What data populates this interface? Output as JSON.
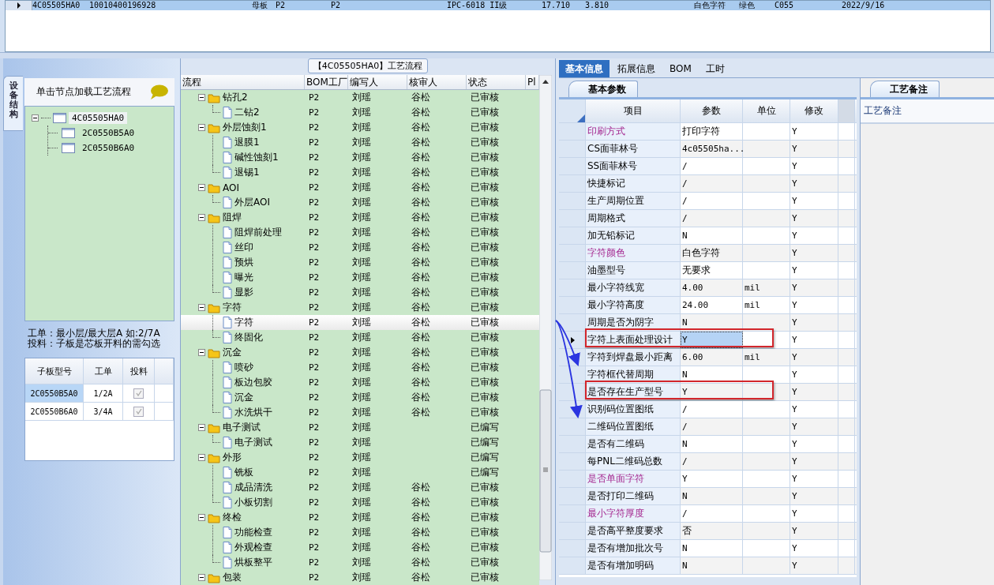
{
  "top_grid": {
    "rows": [
      {
        "selected": true,
        "cells": [
          "4C05505HA0",
          "10010400196928",
          "母板",
          "P2",
          "P2",
          "IPC-6018 II级",
          "17.710",
          "3.810",
          "白色字符",
          "绿色",
          "C055",
          "2022/9/16"
        ]
      }
    ]
  },
  "left_panel": {
    "side_tab": "设备结构",
    "hint": "单击节点加载工艺流程",
    "tree": [
      {
        "label": "4C05505HA0",
        "expanded": true,
        "selected": true,
        "children": [
          {
            "label": "2C0550B5A0",
            "selected": false
          },
          {
            "label": "2C0550B6A0",
            "selected": false
          }
        ]
      }
    ],
    "notes": [
      "工单：最小层/最大层A 如:2/7A",
      "投料：子板是芯板开料的需勾选"
    ],
    "table": {
      "columns": [
        "子板型号",
        "工单",
        "投料"
      ],
      "rows": [
        {
          "board": "2C0550B5A0",
          "order": "1/2A",
          "checked": true,
          "selected": true
        },
        {
          "board": "2C0550B6A0",
          "order": "3/4A",
          "checked": true,
          "selected": false
        }
      ]
    }
  },
  "flow": {
    "title": "【4C05505HA0】工艺流程",
    "columns": [
      "流程",
      "BOM工厂",
      "编写人",
      "核审人",
      "状态",
      "Pl"
    ],
    "tree": [
      {
        "kind": "folder",
        "label": "钻孔2",
        "expanded": true,
        "selected": false,
        "bom": "P2",
        "author": "刘瑶",
        "reviewer": "谷松",
        "status": "已审核",
        "children": [
          {
            "kind": "file",
            "label": "二钻2",
            "selected": false,
            "bom": "P2",
            "author": "刘瑶",
            "reviewer": "谷松",
            "status": "已审核"
          }
        ]
      },
      {
        "kind": "folder",
        "label": "外层蚀刻1",
        "expanded": true,
        "selected": false,
        "bom": "P2",
        "author": "刘瑶",
        "reviewer": "谷松",
        "status": "已审核",
        "children": [
          {
            "kind": "file",
            "label": "退膜1",
            "selected": false,
            "bom": "P2",
            "author": "刘瑶",
            "reviewer": "谷松",
            "status": "已审核"
          },
          {
            "kind": "file",
            "label": "碱性蚀刻1",
            "selected": false,
            "bom": "P2",
            "author": "刘瑶",
            "reviewer": "谷松",
            "status": "已审核"
          },
          {
            "kind": "file",
            "label": "退锡1",
            "selected": false,
            "bom": "P2",
            "author": "刘瑶",
            "reviewer": "谷松",
            "status": "已审核"
          }
        ]
      },
      {
        "kind": "folder",
        "label": "AOI",
        "expanded": true,
        "selected": false,
        "bom": "P2",
        "author": "刘瑶",
        "reviewer": "谷松",
        "status": "已审核",
        "children": [
          {
            "kind": "file",
            "label": "外层AOI",
            "selected": false,
            "bom": "P2",
            "author": "刘瑶",
            "reviewer": "谷松",
            "status": "已审核"
          }
        ]
      },
      {
        "kind": "folder",
        "label": "阻焊",
        "expanded": true,
        "selected": false,
        "bom": "P2",
        "author": "刘瑶",
        "reviewer": "谷松",
        "status": "已审核",
        "children": [
          {
            "kind": "file",
            "label": "阻焊前处理",
            "selected": false,
            "bom": "P2",
            "author": "刘瑶",
            "reviewer": "谷松",
            "status": "已审核"
          },
          {
            "kind": "file",
            "label": "丝印",
            "selected": false,
            "bom": "P2",
            "author": "刘瑶",
            "reviewer": "谷松",
            "status": "已审核"
          },
          {
            "kind": "file",
            "label": "预烘",
            "selected": false,
            "bom": "P2",
            "author": "刘瑶",
            "reviewer": "谷松",
            "status": "已审核"
          },
          {
            "kind": "file",
            "label": "曝光",
            "selected": false,
            "bom": "P2",
            "author": "刘瑶",
            "reviewer": "谷松",
            "status": "已审核"
          },
          {
            "kind": "file",
            "label": "显影",
            "selected": false,
            "bom": "P2",
            "author": "刘瑶",
            "reviewer": "谷松",
            "status": "已审核"
          }
        ]
      },
      {
        "kind": "folder",
        "label": "字符",
        "expanded": true,
        "selected": false,
        "bom": "P2",
        "author": "刘瑶",
        "reviewer": "谷松",
        "status": "已审核",
        "children": [
          {
            "kind": "file",
            "label": "字符",
            "selected": true,
            "bom": "P2",
            "author": "刘瑶",
            "reviewer": "谷松",
            "status": "已审核"
          },
          {
            "kind": "file",
            "label": "终固化",
            "selected": false,
            "bom": "P2",
            "author": "刘瑶",
            "reviewer": "谷松",
            "status": "已审核"
          }
        ]
      },
      {
        "kind": "folder",
        "label": "沉金",
        "expanded": true,
        "selected": false,
        "bom": "P2",
        "author": "刘瑶",
        "reviewer": "谷松",
        "status": "已审核",
        "children": [
          {
            "kind": "file",
            "label": "喷砂",
            "selected": false,
            "bom": "P2",
            "author": "刘瑶",
            "reviewer": "谷松",
            "status": "已审核"
          },
          {
            "kind": "file",
            "label": "板边包胶",
            "selected": false,
            "bom": "P2",
            "author": "刘瑶",
            "reviewer": "谷松",
            "status": "已审核"
          },
          {
            "kind": "file",
            "label": "沉金",
            "selected": false,
            "bom": "P2",
            "author": "刘瑶",
            "reviewer": "谷松",
            "status": "已审核"
          },
          {
            "kind": "file",
            "label": "水洗烘干",
            "selected": false,
            "bom": "P2",
            "author": "刘瑶",
            "reviewer": "谷松",
            "status": "已审核"
          }
        ]
      },
      {
        "kind": "folder",
        "label": "电子测试",
        "expanded": true,
        "selected": false,
        "bom": "P2",
        "author": "刘瑶",
        "status": "已编写",
        "children": [
          {
            "kind": "file",
            "label": "电子测试",
            "selected": false,
            "bom": "P2",
            "author": "刘瑶",
            "status": "已编写"
          }
        ]
      },
      {
        "kind": "folder",
        "label": "外形",
        "expanded": true,
        "selected": false,
        "bom": "P2",
        "author": "刘瑶",
        "status": "已编写",
        "children": [
          {
            "kind": "file",
            "label": "铣板",
            "selected": false,
            "bom": "P2",
            "author": "刘瑶",
            "status": "已编写"
          },
          {
            "kind": "file",
            "label": "成品清洗",
            "selected": false,
            "bom": "P2",
            "author": "刘瑶",
            "reviewer": "谷松",
            "status": "已审核"
          },
          {
            "kind": "file",
            "label": "小板切割",
            "selected": false,
            "bom": "P2",
            "author": "刘瑶",
            "reviewer": "谷松",
            "status": "已审核"
          }
        ]
      },
      {
        "kind": "folder",
        "label": "终检",
        "expanded": true,
        "selected": false,
        "bom": "P2",
        "author": "刘瑶",
        "reviewer": "谷松",
        "status": "已审核",
        "children": [
          {
            "kind": "file",
            "label": "功能检查",
            "selected": false,
            "bom": "P2",
            "author": "刘瑶",
            "reviewer": "谷松",
            "status": "已审核"
          },
          {
            "kind": "file",
            "label": "外观检查",
            "selected": false,
            "bom": "P2",
            "author": "刘瑶",
            "reviewer": "谷松",
            "status": "已审核"
          },
          {
            "kind": "file",
            "label": "烘板整平",
            "selected": false,
            "bom": "P2",
            "author": "刘瑶",
            "reviewer": "谷松",
            "status": "已审核"
          }
        ]
      },
      {
        "kind": "folder",
        "label": "包装",
        "expanded": true,
        "selected": false,
        "bom": "P2",
        "author": "刘瑶",
        "reviewer": "谷松",
        "status": "已审核"
      }
    ]
  },
  "params": {
    "tabs": [
      {
        "label": "基本信息",
        "selected": true
      },
      {
        "label": "拓展信息",
        "selected": false
      },
      {
        "label": "BOM",
        "selected": false
      },
      {
        "label": "工时",
        "selected": false
      }
    ],
    "section_tab": "基本参数",
    "columns": [
      "项目",
      "参数",
      "单位",
      "修改"
    ],
    "rows": [
      {
        "item": "印刷方式",
        "value": "打印字符",
        "modified": "Y",
        "emphasis": true,
        "selected": false,
        "highlighted": false
      },
      {
        "item": "CS面菲林号",
        "value": "4c05505ha...",
        "modified": "Y",
        "emphasis": false,
        "selected": false,
        "highlighted": false
      },
      {
        "item": "SS面菲林号",
        "value": "/",
        "modified": "Y",
        "emphasis": false,
        "selected": false,
        "highlighted": false
      },
      {
        "item": "快捷标记",
        "value": "/",
        "modified": "Y",
        "emphasis": false,
        "selected": false,
        "highlighted": false
      },
      {
        "item": "生产周期位置",
        "value": "/",
        "modified": "Y",
        "emphasis": false,
        "selected": false,
        "highlighted": false
      },
      {
        "item": "周期格式",
        "value": "/",
        "modified": "Y",
        "emphasis": false,
        "selected": false,
        "highlighted": false
      },
      {
        "item": "加无铅标记",
        "value": "N",
        "modified": "Y",
        "emphasis": false,
        "selected": false,
        "highlighted": false
      },
      {
        "item": "字符颜色",
        "value": "白色字符",
        "modified": "Y",
        "emphasis": true,
        "selected": false,
        "highlighted": false
      },
      {
        "item": "油墨型号",
        "value": "无要求",
        "modified": "Y",
        "emphasis": false,
        "selected": false,
        "highlighted": false
      },
      {
        "item": "最小字符线宽",
        "value": "4.00",
        "unit": "mil",
        "modified": "Y",
        "emphasis": false,
        "selected": false,
        "highlighted": false
      },
      {
        "item": "最小字符高度",
        "value": "24.00",
        "unit": "mil",
        "modified": "Y",
        "emphasis": false,
        "selected": false,
        "highlighted": false
      },
      {
        "item": "周期是否为阴字",
        "value": "N",
        "modified": "Y",
        "emphasis": false,
        "selected": false,
        "highlighted": false
      },
      {
        "item": "字符上表面处理设计",
        "value": "Y",
        "modified": "Y",
        "emphasis": false,
        "selected": true,
        "highlighted": true
      },
      {
        "item": "字符到焊盘最小距离",
        "value": "6.00",
        "unit": "mil",
        "modified": "Y",
        "emphasis": false,
        "selected": false,
        "highlighted": false
      },
      {
        "item": "字符框代替周期",
        "value": "N",
        "modified": "Y",
        "emphasis": false,
        "selected": false,
        "highlighted": false
      },
      {
        "item": "是否存在生产型号",
        "value": "Y",
        "modified": "Y",
        "emphasis": false,
        "selected": false,
        "highlighted": true
      },
      {
        "item": "识别码位置图纸",
        "value": "/",
        "modified": "Y",
        "emphasis": false,
        "selected": false,
        "highlighted": false
      },
      {
        "item": "二维码位置图纸",
        "value": "/",
        "modified": "Y",
        "emphasis": false,
        "selected": false,
        "highlighted": false
      },
      {
        "item": "是否有二维码",
        "value": "N",
        "modified": "Y",
        "emphasis": false,
        "selected": false,
        "highlighted": false
      },
      {
        "item": "每PNL二维码总数",
        "value": "/",
        "modified": "Y",
        "emphasis": false,
        "selected": false,
        "highlighted": false
      },
      {
        "item": "是否单面字符",
        "value": "Y",
        "modified": "Y",
        "emphasis": true,
        "selected": false,
        "highlighted": false
      },
      {
        "item": "是否打印二维码",
        "value": "N",
        "modified": "Y",
        "emphasis": false,
        "selected": false,
        "highlighted": false
      },
      {
        "item": "最小字符厚度",
        "value": "/",
        "modified": "Y",
        "emphasis": true,
        "selected": false,
        "highlighted": false
      },
      {
        "item": "是否高平整度要求",
        "value": "否",
        "modified": "Y",
        "emphasis": false,
        "selected": false,
        "highlighted": false
      },
      {
        "item": "是否有增加批次号",
        "value": "N",
        "modified": "Y",
        "emphasis": false,
        "selected": false,
        "highlighted": false
      },
      {
        "item": "是否有增加明码",
        "value": "N",
        "modified": "Y",
        "emphasis": false,
        "selected": false,
        "highlighted": false
      }
    ]
  },
  "notes_panel": {
    "tab": "工艺备注",
    "label": "工艺备注"
  }
}
